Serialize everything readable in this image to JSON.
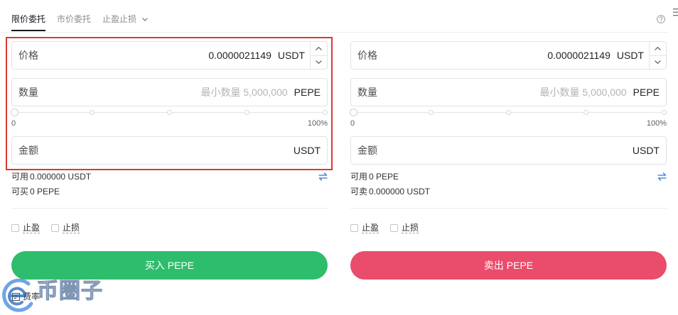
{
  "tabs": [
    {
      "label": "限价委托",
      "active": true
    },
    {
      "label": "市价委托",
      "active": false
    },
    {
      "label": "止盈止损",
      "active": false,
      "has_dropdown": true
    }
  ],
  "icons": {
    "tab_dropdown": "chevron-down-icon",
    "help": "help-circle-icon",
    "menu": "menu-icon",
    "price_up": "chevron-up-icon",
    "price_down": "chevron-down-icon",
    "swap": "swap-icon",
    "fee": "fee-rate-icon",
    "watermark_logo": "watermark-logo-icon"
  },
  "buy": {
    "price": {
      "label": "价格",
      "value": "0.0000021149",
      "unit": "USDT"
    },
    "quantity": {
      "label": "数量",
      "placeholder": "最小数量 5,000,000",
      "unit": "PEPE"
    },
    "slider": {
      "value_percent": 0,
      "min_label": "0",
      "max_label": "100%"
    },
    "amount": {
      "label": "金额",
      "unit": "USDT"
    },
    "available": {
      "label": "可用",
      "value": "0.000000 USDT"
    },
    "max_trade": {
      "label": "可买",
      "value": "0 PEPE"
    },
    "take_profit": {
      "label": "止盈",
      "checked": false
    },
    "stop_loss": {
      "label": "止损",
      "checked": false
    },
    "submit_label": "买入 PEPE"
  },
  "sell": {
    "price": {
      "label": "价格",
      "value": "0.0000021149",
      "unit": "USDT"
    },
    "quantity": {
      "label": "数量",
      "placeholder": "最小数量 5,000,000",
      "unit": "PEPE"
    },
    "slider": {
      "value_percent": 0,
      "min_label": "0",
      "max_label": "100%"
    },
    "amount": {
      "label": "金额",
      "unit": "USDT"
    },
    "available": {
      "label": "可用",
      "value": "0 PEPE"
    },
    "max_trade": {
      "label": "可卖",
      "value": "0.000000 USDT"
    },
    "take_profit": {
      "label": "止盈",
      "checked": false
    },
    "stop_loss": {
      "label": "止损",
      "checked": false
    },
    "submit_label": "卖出 PEPE"
  },
  "fee": {
    "label": "费率"
  },
  "watermark": {
    "text": "币圈子"
  },
  "colors": {
    "buy": "#2ebd6c",
    "sell": "#ea4c6b",
    "highlight": "#d93a30",
    "accent": "#2f73d9"
  }
}
